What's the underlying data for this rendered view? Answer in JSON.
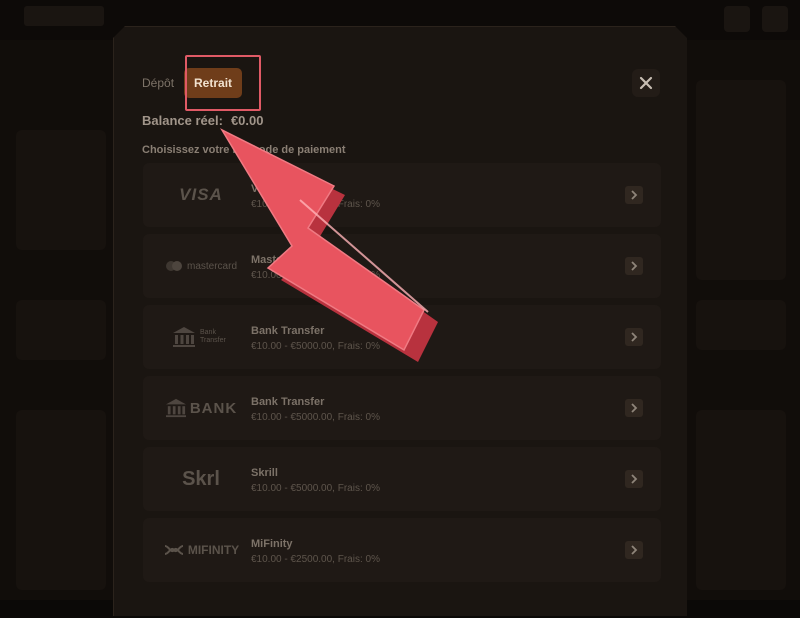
{
  "tabs": {
    "deposit": "Dépôt",
    "withdraw": "Retrait"
  },
  "balance": {
    "label": "Balance réel:",
    "value": "€0.00"
  },
  "choose_label": "Choisissez votre méthode de paiement",
  "methods": [
    {
      "logo": "VISA",
      "name": "Visa",
      "desc": "€10.00 - €3000.00, Frais: 0%"
    },
    {
      "logo": "mastercard",
      "name": "Mastercard",
      "desc": "€10.00 - €3000.00, Frais: 0%"
    },
    {
      "logo": "Bank Transfer",
      "name": "Bank Transfer",
      "desc": "€10.00 - €5000.00, Frais: 0%"
    },
    {
      "logo": "BANK",
      "name": "Bank Transfer",
      "desc": "€10.00 - €5000.00, Frais: 0%"
    },
    {
      "logo": "Skrl",
      "name": "Skrill",
      "desc": "€10.00 - €5000.00, Frais: 0%"
    },
    {
      "logo": "MIFINITY",
      "name": "MiFinity",
      "desc": "€10.00 - €2500.00, Frais: 0%"
    }
  ],
  "colors": {
    "accent": "#6f3d1a",
    "highlight": "#e05a66",
    "arrow": "#e8545f",
    "modal_bg": "#1a1511"
  }
}
